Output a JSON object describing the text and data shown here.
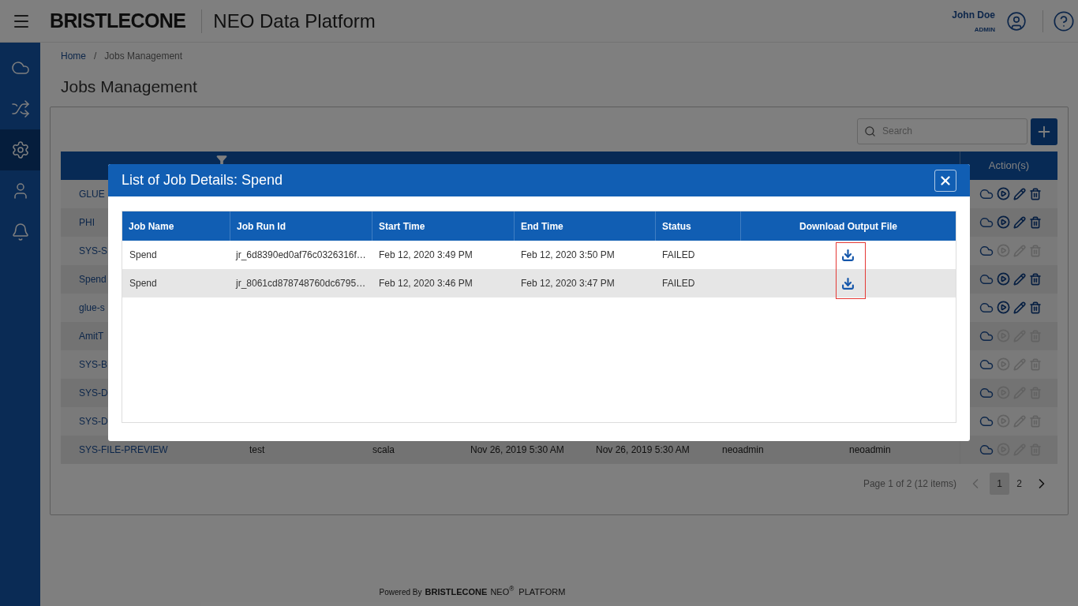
{
  "header": {
    "logo": "BRISTLECONE",
    "title": "NEO Data Platform",
    "user": {
      "name": "John Doe",
      "role": "ADMIN"
    }
  },
  "sidebar": {
    "items": [
      {
        "selected": false
      },
      {
        "selected": false
      },
      {
        "selected": true
      },
      {
        "selected": false
      },
      {
        "selected": false
      }
    ]
  },
  "breadcrumb": [
    "Home",
    "/",
    "Jobs Management"
  ],
  "page_title": "Jobs Management",
  "search": {
    "placeholder": "Search"
  },
  "table": {
    "columns": [
      "Action(s)"
    ],
    "rows": [
      {
        "cells": [
          "GLUE"
        ],
        "enabled": true
      },
      {
        "cells": [
          "PHI"
        ],
        "enabled": true
      },
      {
        "cells": [
          "SYS-S"
        ],
        "enabled": false
      },
      {
        "cells": [
          "Spend"
        ],
        "enabled": true
      },
      {
        "cells": [
          "glue-s"
        ],
        "enabled": true
      },
      {
        "cells": [
          "AmitT"
        ],
        "enabled": false
      },
      {
        "cells": [
          "SYS-B"
        ],
        "enabled": false
      },
      {
        "cells": [
          "SYS-D"
        ],
        "enabled": false
      },
      {
        "cells": [
          "SYS-D"
        ],
        "enabled": false
      },
      {
        "cells": [
          "SYS-FILE-PREVIEW",
          "test",
          "scala",
          "Nov 26, 2019 5:30 AM",
          "Nov 26, 2019 5:30 AM",
          "neoadmin",
          "neoadmin"
        ],
        "enabled": false
      }
    ]
  },
  "pagination": {
    "summary": "Page 1 of 2 (12 items)",
    "pages": [
      {
        "label": "1",
        "selected": true
      },
      {
        "label": "2",
        "selected": false
      }
    ]
  },
  "footer": {
    "powered_by": "Powered By",
    "brand": "BRISTLECONE",
    "product": "NEO$^{®}$",
    "suffix": "PLATFORM"
  },
  "modal": {
    "title": "List of Job Details: Spend",
    "columns": [
      "Job Name",
      "Job Run Id",
      "Start Time",
      "End Time",
      "Status",
      "Download Output File"
    ],
    "rows": [
      {
        "cells": [
          "Spend",
          "jr_6d8390ed0af76c0326316f…",
          "Feb 12, 2020 3:49 PM",
          "Feb 12, 2020 3:50 PM",
          "FAILED"
        ]
      },
      {
        "cells": [
          "Spend",
          "jr_8061cd878748760dc6795…",
          "Feb 12, 2020 3:46 PM",
          "Feb 12, 2020 3:47 PM",
          "FAILED"
        ]
      }
    ]
  }
}
